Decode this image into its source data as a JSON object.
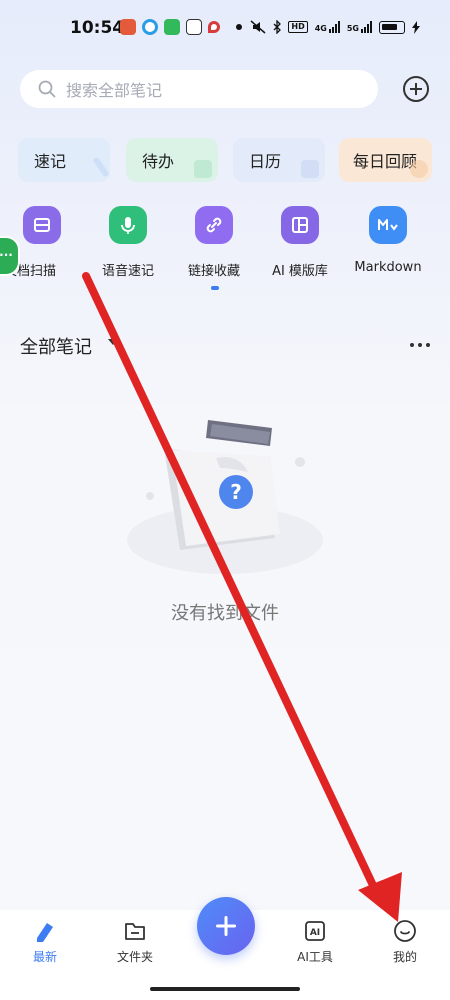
{
  "status_bar": {
    "time": "10:54",
    "network_label": "4G",
    "network_label_2": "5G",
    "hd_label": "HD"
  },
  "search": {
    "placeholder": "搜索全部笔记",
    "icon": "search-icon"
  },
  "quick_cards": [
    {
      "label": "速记",
      "bg": "#e1ecfb",
      "deco": "#c0d6f5"
    },
    {
      "label": "待办",
      "bg": "#dbf2e6",
      "deco": "#a9e2c3"
    },
    {
      "label": "日历",
      "bg": "#e3ebfa",
      "deco": "#c3d3f2"
    },
    {
      "label": "每日回顾",
      "bg": "#fbe7d6",
      "deco": "#f6c8a0"
    }
  ],
  "tools": [
    {
      "label": "文档扫描",
      "color": "#8a6be8",
      "icon": "scan-icon"
    },
    {
      "label": "语音速记",
      "color": "#2fbf7a",
      "icon": "mic-icon"
    },
    {
      "label": "链接收藏",
      "color": "#8f6cf0",
      "icon": "link-icon"
    },
    {
      "label": "AI 模版库",
      "color": "#8668e6",
      "icon": "template-icon"
    },
    {
      "label": "Markdown",
      "color": "#3f8ef5",
      "icon": "markdown-icon"
    }
  ],
  "side_tab": {
    "label": "···"
  },
  "section": {
    "title": "全部笔记"
  },
  "empty_state": {
    "message": "没有找到文件"
  },
  "tab_bar": {
    "tabs": [
      {
        "label": "最新",
        "active": true
      },
      {
        "label": "文件夹",
        "active": false
      },
      {
        "label": "AI工具",
        "active": false
      },
      {
        "label": "我的",
        "active": false
      }
    ]
  },
  "colors": {
    "accent": "#3d7cf2",
    "arrow": "#e02424"
  }
}
